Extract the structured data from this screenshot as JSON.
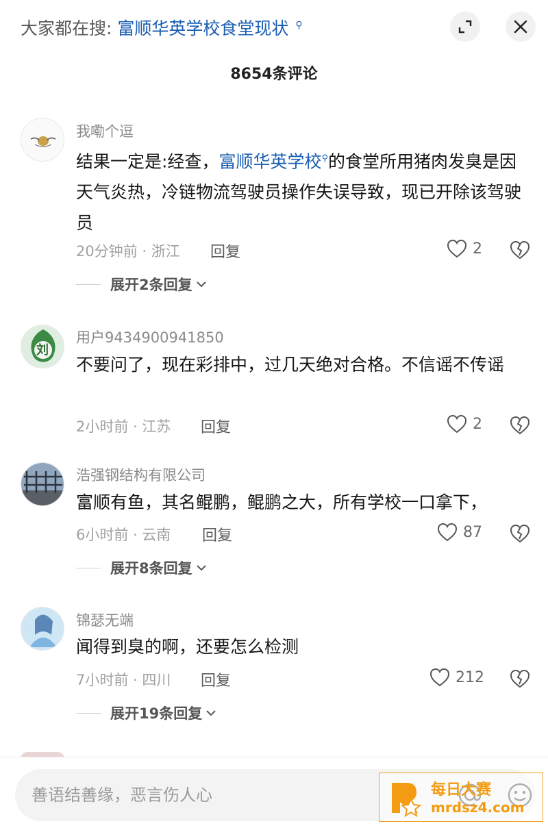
{
  "header": {
    "search_prefix": "大家都在搜:",
    "search_term": "富顺华英学校食堂现状",
    "search_glyph": "⚲"
  },
  "comment_count": "8654条评论",
  "comments": [
    {
      "username": "我嘞个逗",
      "text_before": "结果一定是:经查，",
      "link": "富顺华英学校",
      "text_after": "的食堂所用猪肉发臭是因天气炎热，冷链物流驾驶员操作失误导致，现已开除该驾驶员",
      "meta": "20分钟前 · 浙江",
      "reply": "回复",
      "likes": "2",
      "expand": "展开2条回复"
    },
    {
      "username": "用户9434900941850",
      "text": "不要问了，现在彩排中，过几天绝对合格。不信谣不传谣",
      "meta": "2小时前 · 江苏",
      "reply": "回复",
      "likes": "2"
    },
    {
      "username": "浩强钢结构有限公司",
      "text": "富顺有鱼，其名鲲鹏，鲲鹏之大，所有学校一口拿下，",
      "meta": "6小时前 · 云南",
      "reply": "回复",
      "likes": "87",
      "expand": "展开8条回复"
    },
    {
      "username": "锦瑟无端",
      "text": "闻得到臭的啊，还要怎么检测",
      "meta": "7小时前 · 四川",
      "reply": "回复",
      "likes": "212",
      "expand": "展开19条回复"
    }
  ],
  "avatar2_char": "刘",
  "input": {
    "placeholder": "善语结善缘，恶言伤人心"
  },
  "watermark": {
    "title": "每日大赛",
    "url": "mrdsz4.com"
  },
  "colors": {
    "link": "#1b5fb3",
    "watermark": "#f39c12"
  }
}
